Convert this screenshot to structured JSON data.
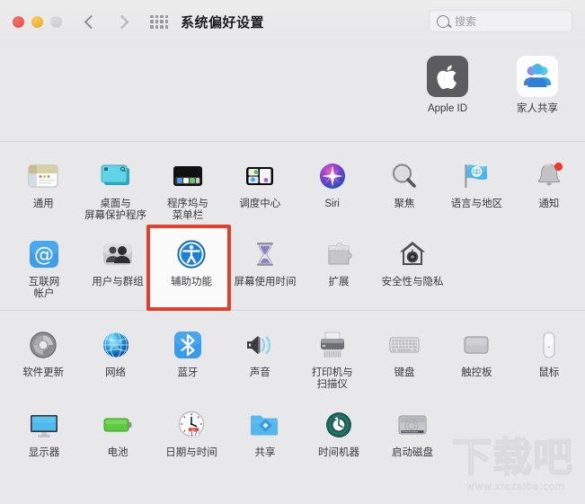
{
  "window": {
    "title": "系统偏好设置",
    "traffic_lights": [
      "close-red",
      "minimize-yellow",
      "zoom-gray-disabled"
    ],
    "back_label": "‹",
    "forward_label": "›",
    "grid_icon": "show-all-grid-icon"
  },
  "search": {
    "placeholder": "搜索",
    "icon": "search-icon"
  },
  "accounts": [
    {
      "label": "Apple ID",
      "icon": "apple-logo-icon"
    },
    {
      "label": "家人共享",
      "icon": "family-sharing-icon"
    }
  ],
  "sections": [
    {
      "name": "personal",
      "items": [
        {
          "label": "通用",
          "icon": "general-window-icon"
        },
        {
          "label": "桌面与\n屏幕保护程序",
          "icon": "desktop-screensaver-icon"
        },
        {
          "label": "程序坞与\n菜单栏",
          "icon": "dock-menubar-icon"
        },
        {
          "label": "调度中心",
          "icon": "mission-control-icon"
        },
        {
          "label": "Siri",
          "icon": "siri-icon"
        },
        {
          "label": "聚焦",
          "icon": "spotlight-magnifier-icon"
        },
        {
          "label": "语言与地区",
          "icon": "language-region-flag-icon"
        },
        {
          "label": "通知",
          "icon": "notifications-bell-icon"
        },
        {
          "label": "互联网\n帐户",
          "icon": "internet-accounts-at-icon"
        },
        {
          "label": "用户与群组",
          "icon": "users-groups-icon"
        },
        {
          "label": "辅助功能",
          "icon": "accessibility-icon",
          "highlighted": true
        },
        {
          "label": "屏幕使用时间",
          "icon": "screen-time-hourglass-icon"
        },
        {
          "label": "扩展",
          "icon": "extensions-puzzle-icon"
        },
        {
          "label": "安全性与隐私",
          "icon": "security-privacy-house-icon"
        }
      ]
    },
    {
      "name": "hardware",
      "items": [
        {
          "label": "软件更新",
          "icon": "software-update-gear-icon"
        },
        {
          "label": "网络",
          "icon": "network-globe-icon"
        },
        {
          "label": "蓝牙",
          "icon": "bluetooth-icon"
        },
        {
          "label": "声音",
          "icon": "sound-speaker-icon"
        },
        {
          "label": "打印机与\n扫描仪",
          "icon": "printers-scanners-icon"
        },
        {
          "label": "键盘",
          "icon": "keyboard-icon"
        },
        {
          "label": "触控板",
          "icon": "trackpad-icon"
        },
        {
          "label": "鼠标",
          "icon": "mouse-icon"
        },
        {
          "label": "显示器",
          "icon": "displays-monitor-icon"
        },
        {
          "label": "电池",
          "icon": "battery-icon"
        },
        {
          "label": "日期与时间",
          "icon": "date-time-clock-icon"
        },
        {
          "label": "共享",
          "icon": "sharing-folder-icon"
        },
        {
          "label": "时间机器",
          "icon": "time-machine-icon"
        },
        {
          "label": "启动磁盘",
          "icon": "startup-disk-icon"
        }
      ]
    }
  ],
  "calendar_icon": {
    "month": "JUL",
    "day": "17"
  },
  "watermark": {
    "text": "下载吧",
    "url": "www.xiazaiba.com"
  },
  "colors": {
    "window_bg": "#e8e8ea",
    "titlebar_bg": "#ececed",
    "highlight_red": "#e0402c",
    "label_text": "#3a3a3c",
    "accent_blue": "#1c8ae0"
  }
}
